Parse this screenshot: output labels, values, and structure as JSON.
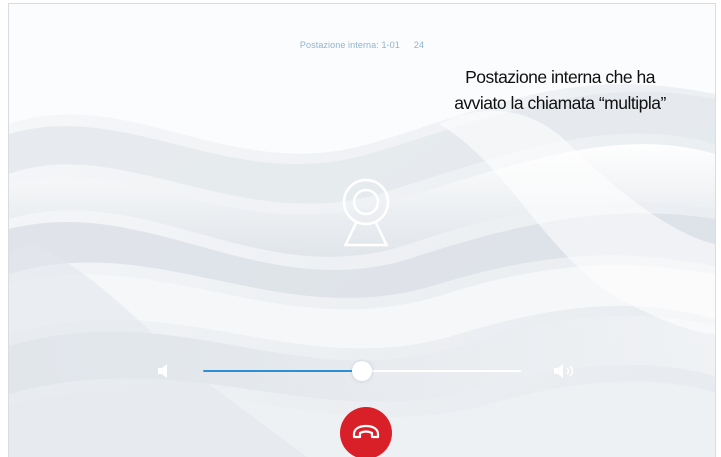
{
  "header": {
    "station_label": "Postazione interna: 1-01",
    "station_number": "24"
  },
  "callout": {
    "line1": "Postazione interna che ha",
    "line2": "avviato la chiamata “multipla”"
  },
  "volume": {
    "level": 0.5,
    "low_icon": "speaker-low-icon",
    "high_icon": "speaker-high-icon"
  },
  "icons": {
    "camera": "webcam-icon",
    "hangup": "phone-hangup-icon"
  },
  "colors": {
    "accent": "#2d8fd0",
    "hangup": "#d92028",
    "header_text": "#8fb4cf"
  }
}
